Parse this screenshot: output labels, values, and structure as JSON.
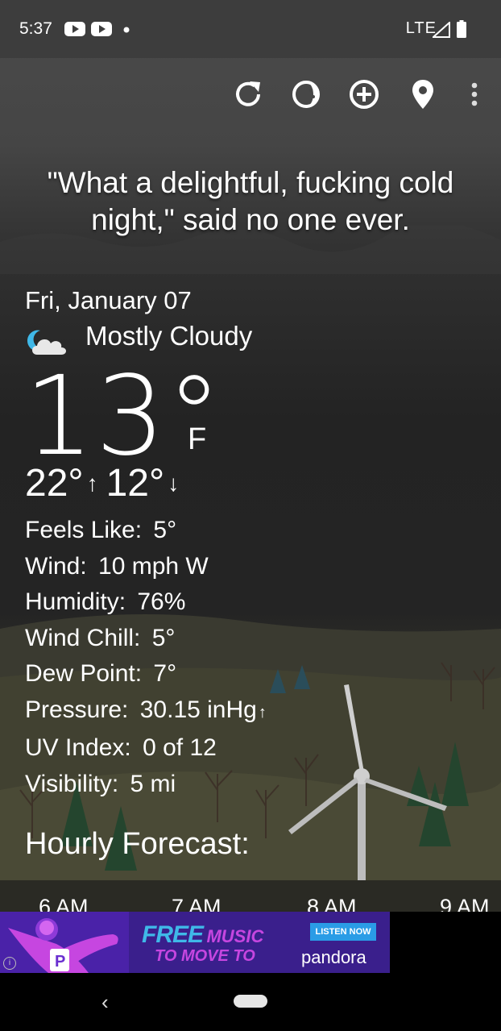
{
  "status_bar": {
    "time": "5:37",
    "network": "LTE",
    "icons": [
      "youtube-icon",
      "youtube-icon",
      "notification-dot-icon",
      "signal-icon",
      "battery-icon"
    ]
  },
  "toolbar": {
    "icons": [
      "refresh-icon",
      "theme-icon",
      "add-location-icon",
      "location-pin-icon",
      "more-vert-icon"
    ]
  },
  "quote": "\"What a delightful, fucking cold night,\" said no one ever.",
  "current": {
    "date": "Fri, January 07",
    "condition": "Mostly Cloudy",
    "condition_icon": "partly-cloudy-night-icon",
    "temp": "13°",
    "unit": "F",
    "high": "22°",
    "low": "12°"
  },
  "details": [
    {
      "label": "Feels Like:",
      "value": "5°"
    },
    {
      "label": "Wind:",
      "value": "10 mph W"
    },
    {
      "label": "Humidity:",
      "value": "76%"
    },
    {
      "label": "Wind Chill:",
      "value": "5°"
    },
    {
      "label": "Dew Point:",
      "value": "7°"
    },
    {
      "label": "Pressure:",
      "value": "30.15 inHg"
    },
    {
      "label": "UV Index:",
      "value": "0 of 12"
    },
    {
      "label": "Visibility:",
      "value": "5 mi"
    }
  ],
  "hourly": {
    "title": "Hourly Forecast:",
    "hours": [
      "6 AM",
      "7 AM",
      "8 AM",
      "9 AM"
    ]
  },
  "ad": {
    "line1": "FREE",
    "line1b": "MUSIC",
    "line2": "TO MOVE TO",
    "cta": "LISTEN NOW",
    "brand": "pandora"
  },
  "colors": {
    "accent_cyan": "#3fb8e8",
    "ad_purple": "#3a1f8c"
  }
}
